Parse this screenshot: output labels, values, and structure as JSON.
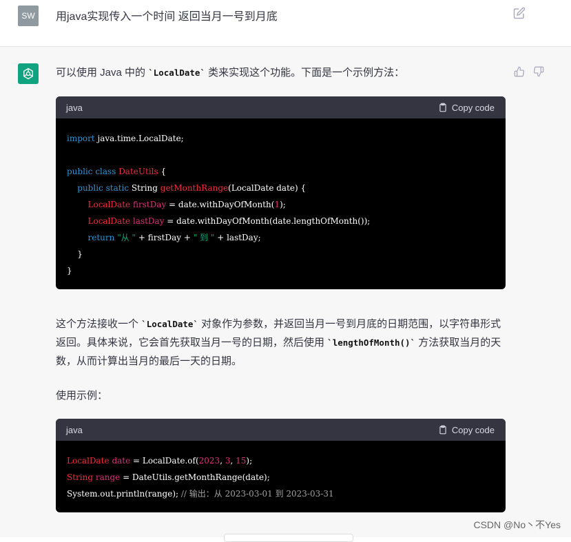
{
  "user": {
    "avatar_initials": "SW",
    "message": "用java实现传入一个时间 返回当月一号到月底",
    "edit_icon": "edit-icon"
  },
  "assistant": {
    "intro_before": "可以使用 Java 中的 ",
    "intro_code": "`LocalDate`",
    "intro_after": " 类来实现这个功能。下面是一个示例方法：",
    "code1": {
      "lang": "java",
      "copy_label": "Copy code"
    },
    "explain": {
      "part1": "这个方法接收一个 ",
      "code_a": "`LocalDate`",
      "part2": " 对象作为参数，并返回当月一号到月底的日期范围，以字符串形式返回。具体来说，它会首先获取当月一号的日期，然后使用 ",
      "code_b": "`lengthOfMonth()`",
      "part3": " 方法获取当月的天数，从而计算出当月的最后一天的日期。"
    },
    "usage_label": "使用示例：",
    "code2": {
      "lang": "java",
      "copy_label": "Copy code"
    }
  },
  "watermark": "CSDN @No丶不Yes",
  "colors": {
    "keyword": "#2e95d3",
    "type": "#f22c3d",
    "name": "#df3079",
    "string": "#00a67d",
    "bot_avatar": "#10a37f"
  }
}
